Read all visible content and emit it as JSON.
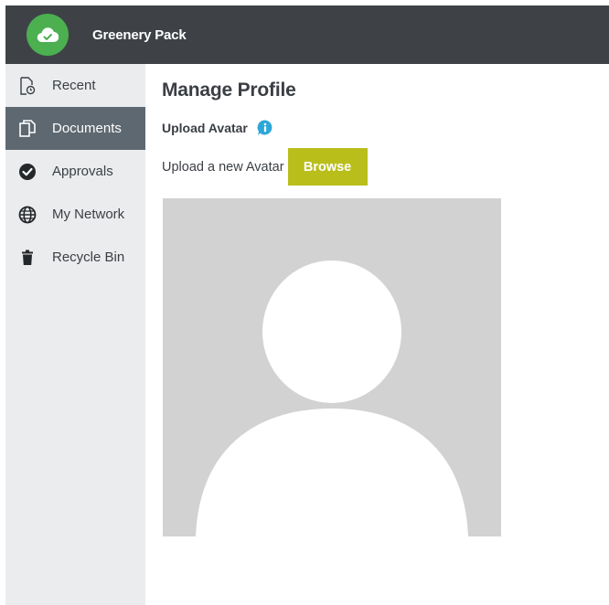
{
  "app": {
    "title": "Greenery Pack",
    "brand_color": "#4caf50",
    "logo_icon": "cloud-check-icon"
  },
  "sidebar": {
    "items": [
      {
        "label": "Recent",
        "icon": "recent-document-icon",
        "active": false
      },
      {
        "label": "Documents",
        "icon": "documents-icon",
        "active": true
      },
      {
        "label": "Approvals",
        "icon": "check-circle-icon",
        "active": false
      },
      {
        "label": "My Network",
        "icon": "globe-icon",
        "active": false
      },
      {
        "label": "Recycle Bin",
        "icon": "trash-icon",
        "active": false
      }
    ]
  },
  "main": {
    "title": "Manage Profile",
    "section_title": "Upload Avatar",
    "upload_text": "Upload a new Avatar",
    "browse_label": "Browse",
    "accent_color": "#b9be1b",
    "info_color": "#2ea7d8",
    "avatar_icon": "default-avatar-silhouette"
  }
}
